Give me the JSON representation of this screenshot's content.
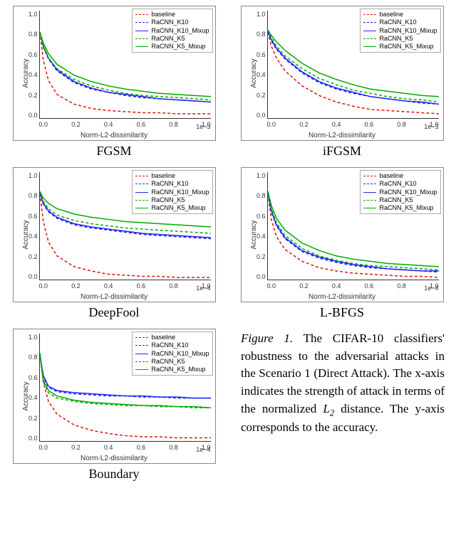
{
  "legend": {
    "series": [
      {
        "key": "baseline",
        "name": "baseline",
        "color": "#d11",
        "dash": true
      },
      {
        "key": "k10",
        "name": "RaCNN_K10",
        "color": "#22f",
        "dash": true
      },
      {
        "key": "k10m",
        "name": "RaCNN_K10_Mixup",
        "color": "#22f",
        "dash": false
      },
      {
        "key": "k5",
        "name": "RaCNN_K5",
        "color": "#0a0",
        "dash": true
      },
      {
        "key": "k5m",
        "name": "RaCNN_K5_Mixup",
        "color": "#0a0",
        "dash": false
      }
    ]
  },
  "axis": {
    "xlabel": "Norm-L2-dissimilarity",
    "ylabel": "Accuracy",
    "xlim": [
      0.0,
      1.0
    ],
    "ylim": [
      0.0,
      1.0
    ],
    "xticks": [
      "0.0",
      "0.2",
      "0.4",
      "0.6",
      "0.8",
      "1.0"
    ],
    "yticks": [
      "0.0",
      "0.2",
      "0.4",
      "0.6",
      "0.8",
      "1.0"
    ]
  },
  "charts": [
    {
      "id": "fgsm",
      "title": "FGSM",
      "xmult": "1e−3"
    },
    {
      "id": "ifgsm",
      "title": "iFGSM",
      "xmult": "1e−3"
    },
    {
      "id": "deepfool",
      "title": "DeepFool",
      "xmult": "1e−4"
    },
    {
      "id": "lbfgs",
      "title": "L-BFGS",
      "xmult": "1e−4"
    },
    {
      "id": "boundary",
      "title": "Boundary",
      "xmult": "1e−4"
    }
  ],
  "chart_data": [
    {
      "type": "line",
      "id": "fgsm",
      "title": "FGSM",
      "xlabel": "Norm-L2-dissimilarity",
      "ylabel": "Accuracy",
      "x": [
        0.0,
        0.02,
        0.05,
        0.1,
        0.2,
        0.3,
        0.4,
        0.5,
        0.6,
        0.7,
        0.8,
        0.9,
        1.0
      ],
      "xlim": [
        0,
        1
      ],
      "ylim": [
        0,
        1
      ],
      "series": [
        {
          "name": "baseline",
          "values": [
            0.8,
            0.54,
            0.35,
            0.22,
            0.13,
            0.09,
            0.07,
            0.06,
            0.05,
            0.05,
            0.04,
            0.04,
            0.04
          ]
        },
        {
          "name": "RaCNN_K10",
          "values": [
            0.8,
            0.66,
            0.55,
            0.44,
            0.33,
            0.27,
            0.24,
            0.21,
            0.19,
            0.18,
            0.17,
            0.16,
            0.15
          ]
        },
        {
          "name": "RaCNN_K10_Mixup",
          "values": [
            0.8,
            0.67,
            0.56,
            0.45,
            0.34,
            0.28,
            0.24,
            0.22,
            0.2,
            0.18,
            0.17,
            0.16,
            0.15
          ]
        },
        {
          "name": "RaCNN_K5",
          "values": [
            0.8,
            0.67,
            0.56,
            0.46,
            0.36,
            0.3,
            0.26,
            0.23,
            0.21,
            0.2,
            0.19,
            0.18,
            0.17
          ]
        },
        {
          "name": "RaCNN_K5_Mixup",
          "values": [
            0.8,
            0.7,
            0.6,
            0.5,
            0.4,
            0.34,
            0.3,
            0.27,
            0.25,
            0.23,
            0.22,
            0.21,
            0.2
          ]
        }
      ]
    },
    {
      "type": "line",
      "id": "ifgsm",
      "title": "iFGSM",
      "xlabel": "Norm-L2-dissimilarity",
      "ylabel": "Accuracy",
      "x": [
        0.0,
        0.02,
        0.05,
        0.1,
        0.2,
        0.3,
        0.4,
        0.5,
        0.6,
        0.7,
        0.8,
        0.9,
        1.0
      ],
      "xlim": [
        0,
        1
      ],
      "ylim": [
        0,
        1
      ],
      "series": [
        {
          "name": "baseline",
          "values": [
            0.8,
            0.67,
            0.56,
            0.44,
            0.3,
            0.21,
            0.15,
            0.11,
            0.08,
            0.07,
            0.06,
            0.05,
            0.04
          ]
        },
        {
          "name": "RaCNN_K10",
          "values": [
            0.8,
            0.72,
            0.64,
            0.55,
            0.42,
            0.33,
            0.27,
            0.23,
            0.2,
            0.18,
            0.16,
            0.14,
            0.13
          ]
        },
        {
          "name": "RaCNN_K10_Mixup",
          "values": [
            0.8,
            0.73,
            0.65,
            0.56,
            0.43,
            0.34,
            0.28,
            0.24,
            0.2,
            0.18,
            0.16,
            0.15,
            0.13
          ]
        },
        {
          "name": "RaCNN_K5",
          "values": [
            0.82,
            0.75,
            0.67,
            0.58,
            0.46,
            0.37,
            0.31,
            0.26,
            0.23,
            0.2,
            0.18,
            0.17,
            0.15
          ]
        },
        {
          "name": "RaCNN_K5_Mixup",
          "values": [
            0.82,
            0.77,
            0.71,
            0.63,
            0.51,
            0.42,
            0.36,
            0.31,
            0.27,
            0.25,
            0.23,
            0.21,
            0.2
          ]
        }
      ]
    },
    {
      "type": "line",
      "id": "deepfool",
      "title": "DeepFool",
      "xlabel": "Norm-L2-dissimilarity",
      "ylabel": "Accuracy",
      "x": [
        0.0,
        0.02,
        0.05,
        0.1,
        0.2,
        0.3,
        0.4,
        0.5,
        0.6,
        0.7,
        0.8,
        0.9,
        1.0
      ],
      "xlim": [
        0,
        1
      ],
      "ylim": [
        0,
        1
      ],
      "series": [
        {
          "name": "baseline",
          "values": [
            0.8,
            0.54,
            0.35,
            0.22,
            0.12,
            0.08,
            0.05,
            0.04,
            0.03,
            0.03,
            0.02,
            0.02,
            0.02
          ]
        },
        {
          "name": "RaCNN_K10",
          "values": [
            0.8,
            0.7,
            0.63,
            0.57,
            0.51,
            0.48,
            0.46,
            0.44,
            0.42,
            0.41,
            0.4,
            0.39,
            0.38
          ]
        },
        {
          "name": "RaCNN_K10_Mixup",
          "values": [
            0.8,
            0.71,
            0.64,
            0.58,
            0.52,
            0.49,
            0.47,
            0.45,
            0.43,
            0.42,
            0.41,
            0.4,
            0.39
          ]
        },
        {
          "name": "RaCNN_K5",
          "values": [
            0.82,
            0.73,
            0.66,
            0.6,
            0.55,
            0.52,
            0.5,
            0.48,
            0.47,
            0.46,
            0.45,
            0.44,
            0.43
          ]
        },
        {
          "name": "RaCNN_K5_Mixup",
          "values": [
            0.82,
            0.76,
            0.71,
            0.66,
            0.61,
            0.58,
            0.56,
            0.54,
            0.53,
            0.52,
            0.51,
            0.5,
            0.49
          ]
        }
      ]
    },
    {
      "type": "line",
      "id": "lbfgs",
      "title": "L-BFGS",
      "xlabel": "Norm-L2-dissimilarity",
      "ylabel": "Accuracy",
      "x": [
        0.0,
        0.02,
        0.05,
        0.1,
        0.2,
        0.3,
        0.4,
        0.5,
        0.6,
        0.7,
        0.8,
        0.9,
        1.0
      ],
      "xlim": [
        0,
        1
      ],
      "ylim": [
        0,
        1
      ],
      "series": [
        {
          "name": "baseline",
          "values": [
            0.8,
            0.56,
            0.4,
            0.28,
            0.17,
            0.11,
            0.08,
            0.06,
            0.05,
            0.04,
            0.03,
            0.03,
            0.02
          ]
        },
        {
          "name": "RaCNN_K10",
          "values": [
            0.8,
            0.63,
            0.5,
            0.38,
            0.26,
            0.2,
            0.16,
            0.13,
            0.11,
            0.1,
            0.09,
            0.08,
            0.07
          ]
        },
        {
          "name": "RaCNN_K10_Mixup",
          "values": [
            0.8,
            0.64,
            0.51,
            0.39,
            0.27,
            0.21,
            0.17,
            0.14,
            0.12,
            0.1,
            0.09,
            0.08,
            0.08
          ]
        },
        {
          "name": "RaCNN_K5",
          "values": [
            0.82,
            0.66,
            0.53,
            0.41,
            0.29,
            0.22,
            0.18,
            0.15,
            0.13,
            0.12,
            0.11,
            0.1,
            0.09
          ]
        },
        {
          "name": "RaCNN_K5_Mixup",
          "values": [
            0.82,
            0.69,
            0.57,
            0.46,
            0.34,
            0.27,
            0.22,
            0.19,
            0.17,
            0.15,
            0.14,
            0.13,
            0.12
          ]
        }
      ]
    },
    {
      "type": "line",
      "id": "boundary",
      "title": "Boundary",
      "xlabel": "Norm-L2-dissimilarity",
      "ylabel": "Accuracy",
      "x": [
        0.0,
        0.02,
        0.05,
        0.1,
        0.2,
        0.3,
        0.4,
        0.5,
        0.6,
        0.7,
        0.8,
        0.9,
        1.0
      ],
      "xlim": [
        0,
        1
      ],
      "ylim": [
        0,
        1
      ],
      "series": [
        {
          "name": "baseline",
          "values": [
            0.8,
            0.55,
            0.37,
            0.25,
            0.15,
            0.1,
            0.07,
            0.05,
            0.04,
            0.04,
            0.03,
            0.03,
            0.03
          ]
        },
        {
          "name": "RaCNN_K10",
          "values": [
            0.8,
            0.6,
            0.5,
            0.46,
            0.44,
            0.43,
            0.42,
            0.42,
            0.41,
            0.41,
            0.4,
            0.4,
            0.4
          ]
        },
        {
          "name": "RaCNN_K10_Mixup",
          "values": [
            0.8,
            0.61,
            0.51,
            0.47,
            0.45,
            0.44,
            0.43,
            0.42,
            0.42,
            0.41,
            0.41,
            0.4,
            0.4
          ]
        },
        {
          "name": "RaCNN_K5",
          "values": [
            0.82,
            0.55,
            0.45,
            0.4,
            0.37,
            0.35,
            0.34,
            0.33,
            0.33,
            0.32,
            0.32,
            0.31,
            0.31
          ]
        },
        {
          "name": "RaCNN_K5_Mixup",
          "values": [
            0.82,
            0.57,
            0.47,
            0.42,
            0.38,
            0.36,
            0.35,
            0.34,
            0.33,
            0.33,
            0.32,
            0.32,
            0.31
          ]
        }
      ]
    }
  ],
  "caption": {
    "label": "Figure 1.",
    "text_a": " The CIFAR-10 classifiers' robustness to the adversarial attacks in the Scenario 1 (Direct Attack). The x-axis indicates the strength of attack in terms of the normalized ",
    "l2": "L",
    "l2sub": "2",
    "text_b": " distance. The y-axis corresponds to the accuracy."
  }
}
